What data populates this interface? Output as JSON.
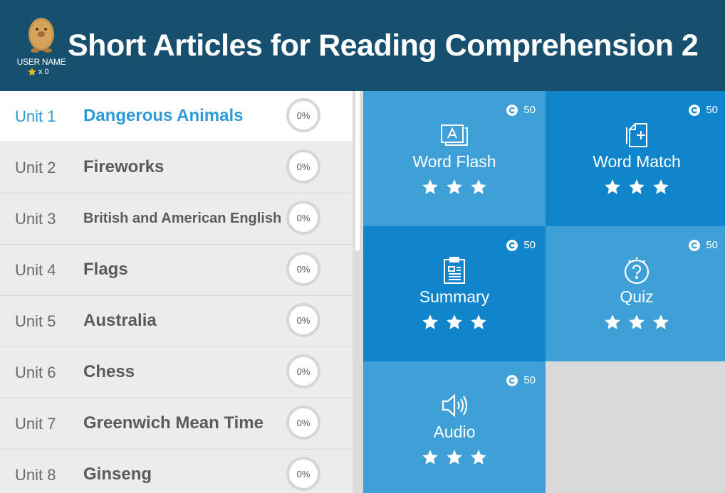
{
  "header": {
    "title": "Short Articles for Reading Comprehension 2",
    "user_name": "USER NAME",
    "star_count": "x 0",
    "colors": {
      "header_bg": "#17506e",
      "accent": "#2e9bd8",
      "star": "#f5b81c"
    }
  },
  "units": [
    {
      "number": "Unit 1",
      "title": "Dangerous Animals",
      "progress": "0%",
      "active": true
    },
    {
      "number": "Unit 2",
      "title": "Fireworks",
      "progress": "0%"
    },
    {
      "number": "Unit 3",
      "title": "British and American English",
      "progress": "0%"
    },
    {
      "number": "Unit 4",
      "title": "Flags",
      "progress": "0%"
    },
    {
      "number": "Unit 5",
      "title": "Australia",
      "progress": "0%"
    },
    {
      "number": "Unit 6",
      "title": "Chess",
      "progress": "0%"
    },
    {
      "number": "Unit 7",
      "title": "Greenwich Mean Time",
      "progress": "0%"
    },
    {
      "number": "Unit 8",
      "title": "Ginseng",
      "progress": "0%"
    }
  ],
  "activities": [
    {
      "label": "Word Flash",
      "points": "50",
      "icon": "flashcard-icon",
      "stars": 3
    },
    {
      "label": "Word Match",
      "points": "50",
      "icon": "card-add-icon",
      "stars": 3
    },
    {
      "label": "Summary",
      "points": "50",
      "icon": "clipboard-icon",
      "stars": 3
    },
    {
      "label": "Quiz",
      "points": "50",
      "icon": "question-bulb-icon",
      "stars": 3
    },
    {
      "label": "Audio",
      "points": "50",
      "icon": "speaker-icon",
      "stars": 3
    }
  ]
}
